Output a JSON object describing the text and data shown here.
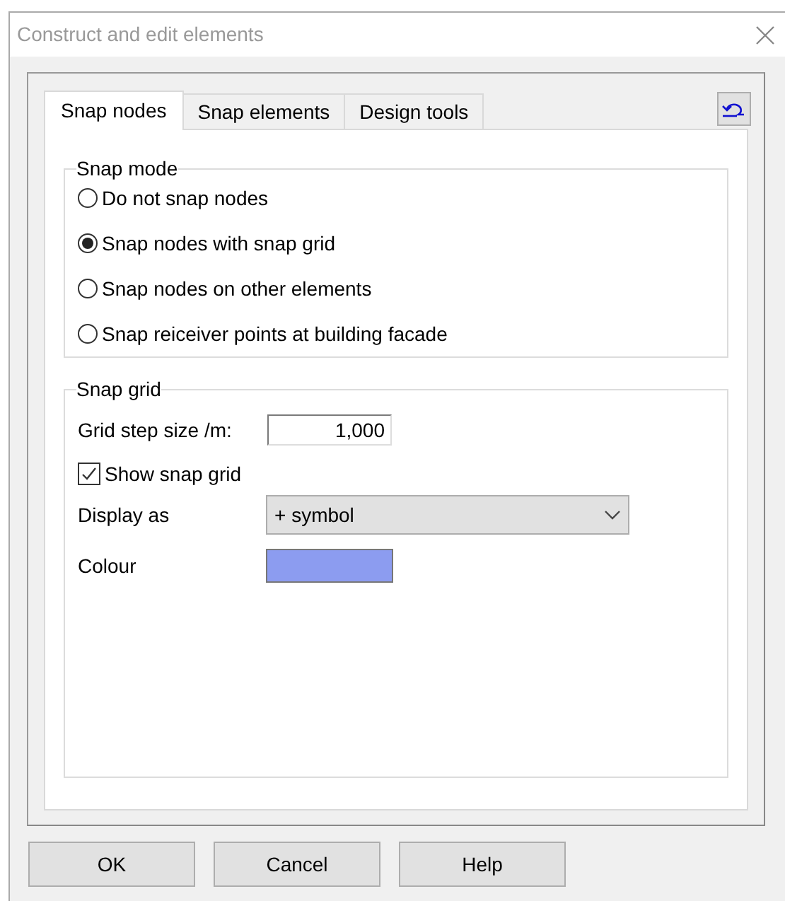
{
  "window": {
    "title": "Construct and edit elements"
  },
  "tabs": [
    {
      "label": "Snap nodes",
      "selected": true
    },
    {
      "label": "Snap elements",
      "selected": false
    },
    {
      "label": "Design tools",
      "selected": false
    }
  ],
  "snap_mode": {
    "title": "Snap mode",
    "options": [
      {
        "label": "Do not snap nodes",
        "selected": false
      },
      {
        "label": "Snap nodes with snap grid",
        "selected": true
      },
      {
        "label": "Snap nodes on other elements",
        "selected": false
      },
      {
        "label": "Snap reiceiver points at building facade",
        "selected": false
      }
    ]
  },
  "snap_grid": {
    "title": "Snap grid",
    "step_label": "Grid step size /m:",
    "step_value": "1,000",
    "show_grid": {
      "label": "Show snap grid",
      "checked": true
    },
    "display_label": "Display as",
    "display_value": "+ symbol",
    "colour_label": "Colour",
    "colour_swatch": {
      "color": "#8c9cf0"
    }
  },
  "buttons": [
    "OK",
    "Cancel",
    "Help"
  ]
}
